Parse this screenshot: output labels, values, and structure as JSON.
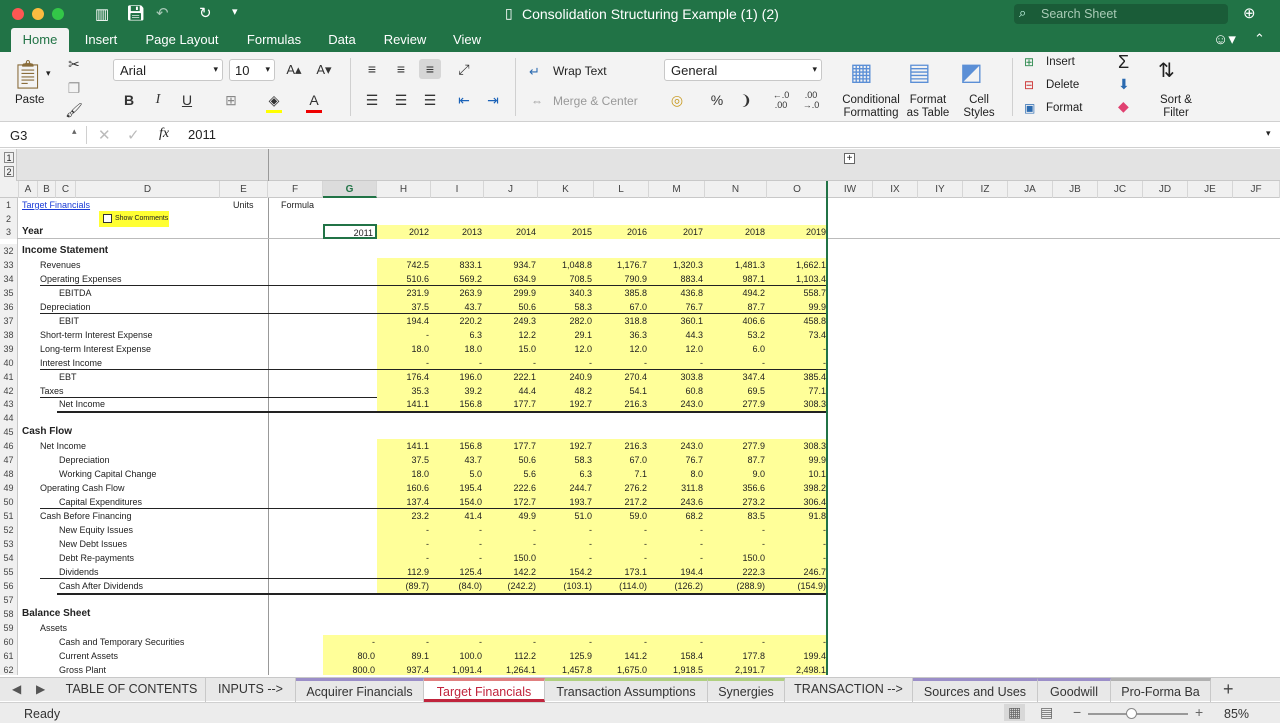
{
  "window": {
    "title": "Consolidation Structuring Example (1) (2)",
    "search_placeholder": "Search Sheet"
  },
  "ribbon_tabs": [
    "Home",
    "Insert",
    "Page Layout",
    "Formulas",
    "Data",
    "Review",
    "View"
  ],
  "ribbon": {
    "paste": "Paste",
    "font_name": "Arial",
    "font_size": "10",
    "bold": "B",
    "italic": "I",
    "underline": "U",
    "wrap_text": "Wrap Text",
    "merge_center": "Merge & Center",
    "number_format": "General",
    "percent": "%",
    "conditional_formatting": [
      "Conditional",
      "Formatting"
    ],
    "format_as_table": [
      "Format",
      "as Table"
    ],
    "cell_styles": [
      "Cell",
      "Styles"
    ],
    "insert": "Insert",
    "delete": "Delete",
    "format": "Format",
    "sort_filter": [
      "Sort &",
      "Filter"
    ]
  },
  "formula_bar": {
    "cell_ref": "G3",
    "fx": "fx",
    "value": "2011"
  },
  "outline_levels": [
    "1",
    "2"
  ],
  "columns": [
    "A",
    "B",
    "C",
    "D",
    "E",
    "F",
    "G",
    "H",
    "I",
    "J",
    "K",
    "L",
    "M",
    "N",
    "O",
    "IW",
    "IX",
    "IY",
    "IZ",
    "JA",
    "JB",
    "JC",
    "JD",
    "JE",
    "JF"
  ],
  "header_rows": {
    "r1": {
      "num": "1",
      "link": "Target Financials",
      "units": "Units",
      "formula": "Formula"
    },
    "r2": {
      "num": "2",
      "show_comments": "Show Comments"
    },
    "r3": {
      "num": "3",
      "label": "Year",
      "years": [
        "2011",
        "2012",
        "2013",
        "2014",
        "2015",
        "2016",
        "2017",
        "2018",
        "2019"
      ]
    }
  },
  "rows": [
    {
      "n": "32",
      "label": "Income Statement",
      "indent": 0,
      "bold": true,
      "vals": []
    },
    {
      "n": "33",
      "label": "Revenues",
      "indent": 1,
      "vals": [
        "",
        "742.5",
        "833.1",
        "934.7",
        "1,048.8",
        "1,176.7",
        "1,320.3",
        "1,481.3",
        "1,662.1"
      ]
    },
    {
      "n": "34",
      "label": "Operating Expenses",
      "indent": 1,
      "vals": [
        "",
        "510.6",
        "569.2",
        "634.9",
        "708.5",
        "790.9",
        "883.4",
        "987.1",
        "1,103.4"
      ]
    },
    {
      "n": "35",
      "label": "EBITDA",
      "indent": 2,
      "vals": [
        "",
        "231.9",
        "263.9",
        "299.9",
        "340.3",
        "385.8",
        "436.8",
        "494.2",
        "558.7"
      ]
    },
    {
      "n": "36",
      "label": "Depreciation",
      "indent": 1,
      "vals": [
        "",
        "37.5",
        "43.7",
        "50.6",
        "58.3",
        "67.0",
        "76.7",
        "87.7",
        "99.9"
      ]
    },
    {
      "n": "37",
      "label": "EBIT",
      "indent": 2,
      "vals": [
        "",
        "194.4",
        "220.2",
        "249.3",
        "282.0",
        "318.8",
        "360.1",
        "406.6",
        "458.8"
      ]
    },
    {
      "n": "38",
      "label": "Short-term Interest Expense",
      "indent": 1,
      "vals": [
        "",
        "-",
        "6.3",
        "12.2",
        "29.1",
        "36.3",
        "44.3",
        "53.2",
        "73.4"
      ]
    },
    {
      "n": "39",
      "label": "Long-term Interest Expense",
      "indent": 1,
      "vals": [
        "",
        "18.0",
        "18.0",
        "15.0",
        "12.0",
        "12.0",
        "12.0",
        "6.0",
        "-"
      ]
    },
    {
      "n": "40",
      "label": "Interest Income",
      "indent": 1,
      "vals": [
        "",
        "-",
        "-",
        "-",
        "-",
        "-",
        "-",
        "-",
        "-"
      ]
    },
    {
      "n": "41",
      "label": "EBT",
      "indent": 2,
      "vals": [
        "",
        "176.4",
        "196.0",
        "222.1",
        "240.9",
        "270.4",
        "303.8",
        "347.4",
        "385.4"
      ]
    },
    {
      "n": "42",
      "label": "Taxes",
      "indent": 1,
      "vals": [
        "",
        "35.3",
        "39.2",
        "44.4",
        "48.2",
        "54.1",
        "60.8",
        "69.5",
        "77.1"
      ]
    },
    {
      "n": "43",
      "label": "Net Income",
      "indent": 2,
      "vals": [
        "",
        "141.1",
        "156.8",
        "177.7",
        "192.7",
        "216.3",
        "243.0",
        "277.9",
        "308.3"
      ]
    },
    {
      "n": "44",
      "label": "",
      "indent": 0,
      "vals": []
    },
    {
      "n": "45",
      "label": "Cash Flow",
      "indent": 0,
      "bold": true,
      "vals": []
    },
    {
      "n": "46",
      "label": "Net Income",
      "indent": 1,
      "vals": [
        "",
        "141.1",
        "156.8",
        "177.7",
        "192.7",
        "216.3",
        "243.0",
        "277.9",
        "308.3"
      ]
    },
    {
      "n": "47",
      "label": "Depreciation",
      "indent": 2,
      "vals": [
        "",
        "37.5",
        "43.7",
        "50.6",
        "58.3",
        "67.0",
        "76.7",
        "87.7",
        "99.9"
      ]
    },
    {
      "n": "48",
      "label": "Working Capital Change",
      "indent": 2,
      "vals": [
        "",
        "18.0",
        "5.0",
        "5.6",
        "6.3",
        "7.1",
        "8.0",
        "9.0",
        "10.1"
      ]
    },
    {
      "n": "49",
      "label": "Operating Cash Flow",
      "indent": 1,
      "vals": [
        "",
        "160.6",
        "195.4",
        "222.6",
        "244.7",
        "276.2",
        "311.8",
        "356.6",
        "398.2"
      ]
    },
    {
      "n": "50",
      "label": "Capital Expenditures",
      "indent": 2,
      "vals": [
        "",
        "137.4",
        "154.0",
        "172.7",
        "193.7",
        "217.2",
        "243.6",
        "273.2",
        "306.4"
      ]
    },
    {
      "n": "51",
      "label": "Cash Before Financing",
      "indent": 1,
      "vals": [
        "",
        "23.2",
        "41.4",
        "49.9",
        "51.0",
        "59.0",
        "68.2",
        "83.5",
        "91.8"
      ]
    },
    {
      "n": "52",
      "label": "New Equity Issues",
      "indent": 2,
      "vals": [
        "",
        "-",
        "-",
        "-",
        "-",
        "-",
        "-",
        "-",
        "-"
      ]
    },
    {
      "n": "53",
      "label": "New Debt Issues",
      "indent": 2,
      "vals": [
        "",
        "-",
        "-",
        "-",
        "-",
        "-",
        "-",
        "-",
        "-"
      ]
    },
    {
      "n": "54",
      "label": "Debt Re-payments",
      "indent": 2,
      "vals": [
        "",
        "-",
        "-",
        "150.0",
        "-",
        "-",
        "-",
        "150.0",
        "-"
      ]
    },
    {
      "n": "55",
      "label": "Dividends",
      "indent": 2,
      "vals": [
        "",
        "112.9",
        "125.4",
        "142.2",
        "154.2",
        "173.1",
        "194.4",
        "222.3",
        "246.7"
      ]
    },
    {
      "n": "56",
      "label": "Cash After Dividends",
      "indent": 2,
      "vals": [
        "",
        "(89.7)",
        "(84.0)",
        "(242.2)",
        "(103.1)",
        "(114.0)",
        "(126.2)",
        "(288.9)",
        "(154.9)"
      ]
    },
    {
      "n": "57",
      "label": "",
      "indent": 0,
      "vals": []
    },
    {
      "n": "58",
      "label": "Balance Sheet",
      "indent": 0,
      "bold": true,
      "vals": []
    },
    {
      "n": "59",
      "label": "Assets",
      "indent": 1,
      "vals": []
    },
    {
      "n": "60",
      "label": "Cash and Temporary Securities",
      "indent": 2,
      "vals": [
        "-",
        "-",
        "-",
        "-",
        "-",
        "-",
        "-",
        "-",
        "-"
      ]
    },
    {
      "n": "61",
      "label": "Current Assets",
      "indent": 2,
      "vals": [
        "80.0",
        "89.1",
        "100.0",
        "112.2",
        "125.9",
        "141.2",
        "158.4",
        "177.8",
        "199.4"
      ]
    },
    {
      "n": "62",
      "label": "Gross Plant",
      "indent": 2,
      "vals": [
        "800.0",
        "937.4",
        "1,091.4",
        "1,264.1",
        "1,457.8",
        "1,675.0",
        "1,918.5",
        "2,191.7",
        "2,498.1"
      ]
    }
  ],
  "sheet_tabs": [
    "TABLE OF CONTENTS",
    "INPUTS -->",
    "Acquirer Financials",
    "Target Financials",
    "Transaction Assumptions",
    "Synergies",
    "TRANSACTION -->",
    "Sources and Uses",
    "Goodwill",
    "Pro-Forma Ba"
  ],
  "active_sheet": "Target Financials",
  "status": {
    "ready": "Ready",
    "zoom": "85%",
    "zoom_level": 0.85
  }
}
